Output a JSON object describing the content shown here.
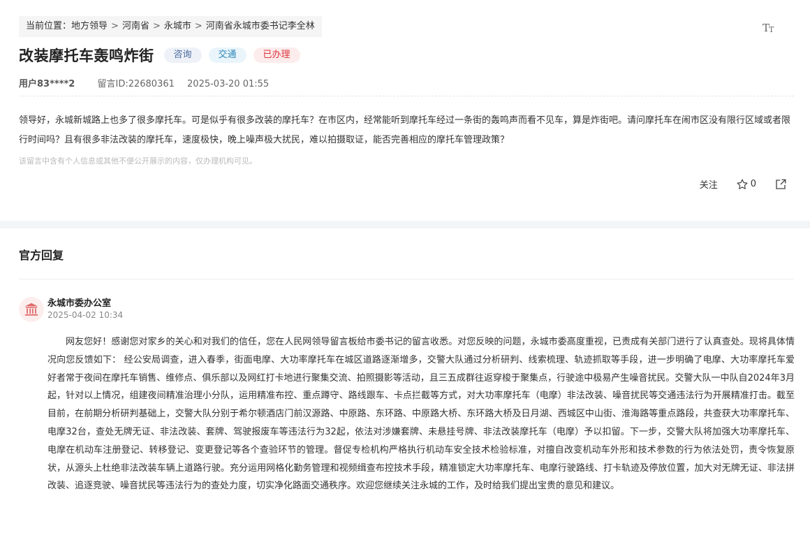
{
  "breadcrumb": {
    "prefix": "当前位置：",
    "items": [
      "地方领导",
      "河南省",
      "永城市",
      "河南省永城市委书记李全林"
    ],
    "separator": ">"
  },
  "title": "改装摩托车轰鸣炸街",
  "tags": {
    "category": "咨询",
    "field": "交通",
    "status": "已办理"
  },
  "meta": {
    "user": "用户83****2",
    "message_id": "留言ID:22680361",
    "datetime": "2025-03-20 01:55"
  },
  "content": "领导好，永城新城路上也多了很多摩托车。可是似乎有很多改装的摩托车？在市区内，经常能听到摩托车经过一条街的轰鸣声而看不见车，算是炸街吧。请问摩托车在闹市区没有限行区域或者限行时间吗？且有很多非法改装的摩托车，速度极快，晚上噪声极大扰民，难以拍摄取证，能否完善相应的摩托车管理政策？",
  "privacy_note": "该留言中含有个人信息或其他不便公开展示的内容，仅办理机构可见。",
  "actions": {
    "follow": "关注",
    "star_count": "0"
  },
  "reply": {
    "heading": "官方回复",
    "org_name": "永城市委办公室",
    "datetime": "2025-04-02 10:34",
    "body": "网友您好！感谢您对家乡的关心和对我们的信任，您在人民网领导留言板给市委书记的留言收悉。对您反映的问题，永城市委高度重视，已责成有关部门进行了认真查处。现将具体情况向您反馈如下： 经公安局调查，进入春季，街面电摩、大功率摩托车在城区道路逐渐增多，交警大队通过分析研判、线索梳理、轨迹抓取等手段，进一步明确了电摩、大功率摩托车爱好者常于夜间在摩托车销售、维修点、俱乐部以及网红打卡地进行聚集交流、拍照摄影等活动，且三五成群往返穿梭于聚集点，行驶途中极易产生噪音扰民。交警大队一中队自2024年3月起，针对以上情况，组建夜间精准治理小分队，运用精准布控、重点蹲守、路线跟车、卡点拦截等方式，对大功率摩托车（电摩）非法改装、噪音扰民等交通违法行为开展精准打击。截至目前，在前期分析研判基础上，交警大队分别于希尔顿酒店门前汉源路、中原路、东环路、中原路大桥、东环路大桥及日月湖、西城区中山街、淮海路等重点路段，共查获大功率摩托车、电摩32台，查处无牌无证、非法改装、套牌、驾驶报废车等违法行为32起，依法对涉嫌套牌、未悬挂号牌、非法改装摩托车（电摩）予以扣留。下一步，交警大队将加强大功率摩托车、电摩在机动车注册登记、转移登记、变更登记等各个查验环节的管理。督促专检机构严格执行机动车安全技术检验标准，对擅自改变机动车外形和技术参数的行为依法处罚，责令恢复原状，从源头上杜绝非法改装车辆上道路行驶。充分运用网格化勤务管理和视频缉查布控技术手段，精准锁定大功率摩托车、电摩行驶路线、打卡轨迹及停放位置，加大对无牌无证、非法拼改装、追逐竞驶、噪音扰民等违法行为的查处力度，切实净化路面交通秩序。欢迎您继续关注永城的工作，及时给我们提出宝贵的意见和建议。"
  },
  "icons": [
    "font-size-icon",
    "star-icon",
    "share-icon",
    "government-building-icon"
  ],
  "colors": {
    "status_red": "#d9363e",
    "traffic_blue": "#2e86b8",
    "consult_blue": "#4a6a9c",
    "avatar_bg": "#fdeeee"
  }
}
